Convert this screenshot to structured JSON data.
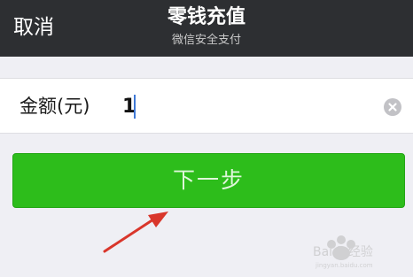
{
  "header": {
    "cancel_label": "取消",
    "title": "零钱充值",
    "subtitle": "微信安全支付"
  },
  "amount": {
    "label": "金额(元)",
    "value": "1"
  },
  "next_button_label": "下一步",
  "colors": {
    "header_bg": "#2d2f32",
    "page_bg": "#efeff4",
    "button_green": "#2dbd1b",
    "annotation_arrow": "#d9362b",
    "cursor_blue": "#3f79d6"
  },
  "icons": {
    "clear": "clear-circle-icon",
    "annotation": "red-arrow-icon",
    "watermark": "baidu-jingyan-watermark"
  },
  "watermark": {
    "text": "Baidu经验",
    "url": "jingyan.baidu.com"
  }
}
